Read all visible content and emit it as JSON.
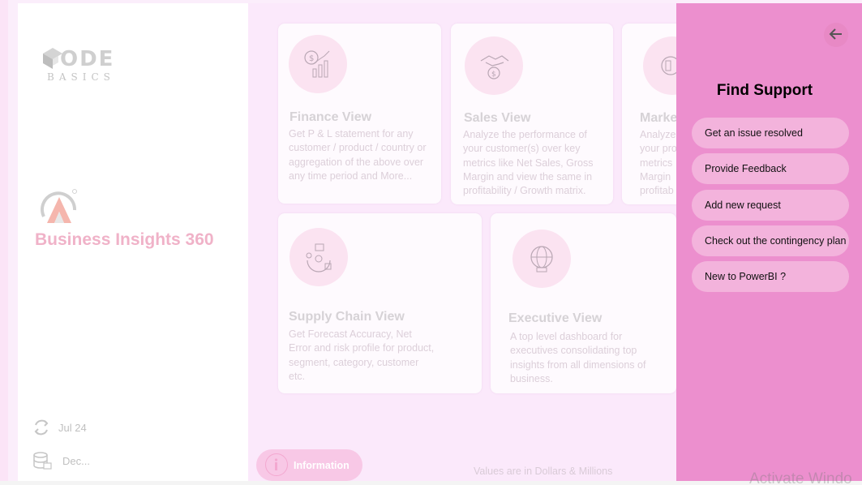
{
  "brand": {
    "logo_word": "ODE",
    "logo_sub": "BASICS",
    "app_title": "Business Insights 360"
  },
  "status": {
    "refresh_date": "Jul 24",
    "source_label": "Dec..."
  },
  "cards": [
    {
      "title": "Finance View",
      "desc": "Get P & L statement for any customer / product / country or aggregation of the above over any time period and More...",
      "icon": "finance-chart-icon"
    },
    {
      "title": "Sales View",
      "desc": "Analyze the performance of your customer(s) over key metrics like Net Sales, Gross Margin and view the same in profitability / Growth matrix.",
      "icon": "handshake-icon"
    },
    {
      "title": "Marke",
      "desc": "Analyze your pro metrics Margin profitab",
      "icon": "marketing-icon"
    },
    {
      "title": "Supply Chain View",
      "desc": "Get Forecast Accuracy, Net Error and risk profile for product, segment, category, customer etc.",
      "icon": "supply-chain-icon"
    },
    {
      "title": "Executive View",
      "desc": "A top level dashboard for executives consolidating top insights from all dimensions of business.",
      "icon": "executive-globe-icon"
    }
  ],
  "footer": {
    "info_label": "Information",
    "values_note": "Values are in Dollars & Millions"
  },
  "support": {
    "title": "Find Support",
    "buttons": [
      "Get an issue resolved",
      "Provide Feedback",
      "Add new request",
      "Check out the contingency plan",
      "New to PowerBI ?"
    ]
  },
  "watermark": "Activate Windo"
}
